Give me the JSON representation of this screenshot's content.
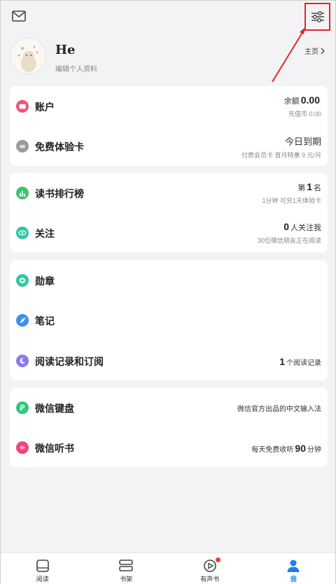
{
  "profile": {
    "name": "He",
    "subtitle": "编辑个人资料",
    "homepage_link": "主页"
  },
  "card1": {
    "account": {
      "label": "账户",
      "balance_prefix": "余额",
      "balance_value": "0.00",
      "sub": "充值币 0.00",
      "icon_color": "#f2547a"
    },
    "trial": {
      "label": "免费体验卡",
      "main": "今日到期",
      "sub": "付费会员卡 首月特惠 9 元/月",
      "icon_color": "#9a9aa0"
    }
  },
  "card2": {
    "ranking": {
      "label": "读书排行榜",
      "prefix": "第",
      "value": "1",
      "suffix": "名",
      "sub": "1分钟 可兑1天体验卡",
      "icon_color": "#3cc56a"
    },
    "follow": {
      "label": "关注",
      "value": "0",
      "suffix": "人关注我",
      "sub": "30位微信朋友正在阅读",
      "icon_color": "#2ec8a8"
    }
  },
  "card3": {
    "medals": {
      "label": "勋章",
      "icon_color": "#2ec8a8"
    },
    "notes": {
      "label": "笔记",
      "icon_color": "#3d8ef0"
    },
    "history": {
      "label": "阅读记录和订阅",
      "value": "1",
      "suffix": "个阅读记录",
      "icon_color": "#8a7bf0"
    }
  },
  "card4": {
    "keyboard": {
      "label": "微信键盘",
      "right": "微信官方出品的中文输入法",
      "icon_color": "#2ec880"
    },
    "listen": {
      "label": "微信听书",
      "prefix": "每天免费收听",
      "value": "90",
      "suffix": "分钟",
      "icon_color": "#f2457a"
    }
  },
  "tabs": [
    {
      "label": "阅读",
      "active": false
    },
    {
      "label": "书架",
      "active": false
    },
    {
      "label": "有声书",
      "active": false
    },
    {
      "label": "我",
      "active": true
    }
  ],
  "colors": {
    "highlight": "#e0262b",
    "accent": "#1e7ef0",
    "badge": "#f23b3b"
  }
}
